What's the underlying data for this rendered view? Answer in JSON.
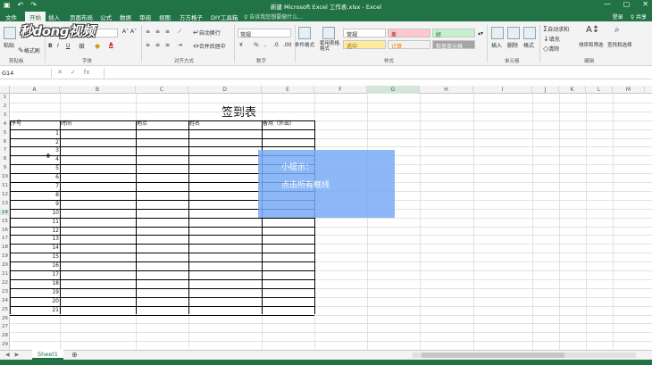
{
  "app": {
    "window_title": "新建 Microsoft Excel 工作表.xlsx - Excel",
    "qat": [
      "↶",
      "↷"
    ],
    "win_controls": [
      "—",
      "▢",
      "✕"
    ]
  },
  "tabs": [
    {
      "label": "文件"
    },
    {
      "label": "开始"
    },
    {
      "label": "插入"
    },
    {
      "label": "页面布局"
    },
    {
      "label": "公式"
    },
    {
      "label": "数据"
    },
    {
      "label": "审阅"
    },
    {
      "label": "视图"
    },
    {
      "label": "方方格子"
    },
    {
      "label": "DIY工具箱"
    }
  ],
  "tell_me": "♀ 告诉我您想要做什么...",
  "user": {
    "login": "登录",
    "share": "♀ 共享"
  },
  "watermark": "秒dong视频",
  "ribbon": {
    "clipboard": {
      "paste": "粘贴",
      "format_painter": "格式刷",
      "group": "剪贴板"
    },
    "font": {
      "group": "字体",
      "bold": "B",
      "italic": "I",
      "underline": "U",
      "grow": "A˄",
      "shrink": "A˅",
      "font_color": "A"
    },
    "alignment": {
      "group": "对齐方式",
      "wrap": "自动换行",
      "merge": "合并后居中"
    },
    "number": {
      "group": "数字",
      "format": "常规",
      "percent": "%",
      "comma": ","
    },
    "styles": {
      "group": "样式",
      "conditional": "条件格式",
      "as_table": "套用表格格式",
      "normal": "常规",
      "bad": "差",
      "good": "好",
      "neutral": "适中",
      "calc": "计算",
      "check": "检查单元格"
    },
    "cells": {
      "group": "单元格",
      "insert": "插入",
      "delete": "删除",
      "format": "格式"
    },
    "editing": {
      "group": "编辑",
      "autosum": "自动求和",
      "fill": "填充",
      "clear": "清除",
      "sort": "排序和筛选",
      "find": "查找和选择"
    }
  },
  "formula_bar": {
    "name_box": "G14",
    "cancel": "✕",
    "enter": "✓",
    "fx": "fx"
  },
  "columns": [
    "A",
    "B",
    "C",
    "D",
    "E",
    "F",
    "G",
    "H",
    "I",
    "J",
    "K",
    "L",
    "M"
  ],
  "rows": [
    "1",
    "2",
    "3",
    "4",
    "5",
    "6",
    "7",
    "8",
    "9",
    "10",
    "11",
    "12",
    "13",
    "14",
    "15",
    "16",
    "17",
    "18",
    "19",
    "20",
    "21",
    "22",
    "23",
    "24",
    "25",
    "26",
    "27",
    "28",
    "29"
  ],
  "sheet": {
    "title": "签到表",
    "headers": [
      "序号",
      "时间",
      "地点",
      "姓名",
      "备用（外出）"
    ],
    "numbers": [
      "1",
      "2",
      "3",
      "4",
      "5",
      "6",
      "7",
      "8",
      "9",
      "10",
      "11",
      "12",
      "13",
      "14",
      "15",
      "16",
      "17",
      "18",
      "19",
      "20",
      "21"
    ]
  },
  "tip": {
    "line1": "小提示：",
    "line2": "点击所有框线"
  },
  "sheets": {
    "active": "Sheet1",
    "add": "⊕",
    "nav": [
      "◀",
      "▶"
    ]
  },
  "colors": {
    "accent": "#217346",
    "tip": "#78acf6"
  }
}
